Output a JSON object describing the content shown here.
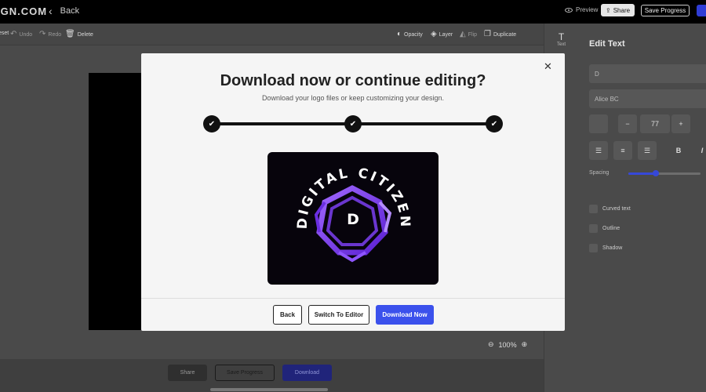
{
  "topbar": {
    "brand": "IGN.COM",
    "back_label": "Back",
    "preview_label": "Preview",
    "share_label": "Share",
    "save_progress_label": "Save Progress"
  },
  "toolbar": {
    "reset_label": "eset",
    "undo_label": "Undo",
    "redo_label": "Redo",
    "delete_label": "Delete",
    "opacity_label": "Opacity",
    "layer_label": "Layer",
    "flip_label": "Flip",
    "duplicate_label": "Duplicate"
  },
  "canvas": {
    "zoom_level": "100%"
  },
  "bottombar": {
    "share_label": "Share",
    "save_progress_label": "Save Progress",
    "download_label": "Download"
  },
  "sidetools": {
    "text_label": "Text"
  },
  "edit_panel": {
    "title": "Edit Text",
    "text_value": "D",
    "font_value": "Alice BC",
    "size_value": "77",
    "spacing_label": "Spacing",
    "spacing_level": 0.38,
    "curved_text_label": "Curved text",
    "outline_label": "Outline",
    "shadow_label": "Shadow"
  },
  "modal": {
    "title": "Download now or continue editing?",
    "subtitle": "Download your logo files or keep customizing your design.",
    "steps_completed": 3,
    "logo": {
      "curved_text": "DIGITAL CITIZEN",
      "monogram": "D",
      "accent_color": "#7b3ff2",
      "background_color": "#07040c"
    },
    "back_label": "Back",
    "switch_label": "Switch To Editor",
    "download_label": "Download Now",
    "download_color": "#3b51ec"
  }
}
